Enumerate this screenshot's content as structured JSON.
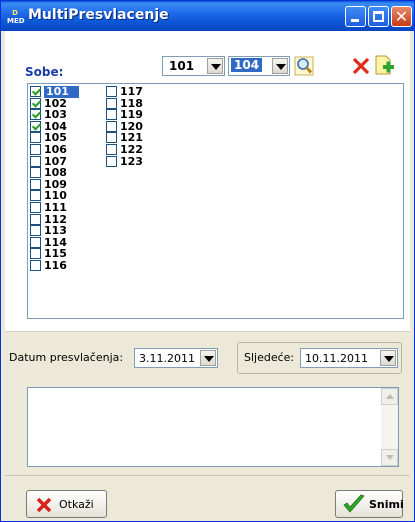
{
  "window": {
    "title": "MultiPresvlacenje",
    "icon_text_top": "D",
    "icon_text_bottom": "MED"
  },
  "rooms": {
    "label": "Sobe:",
    "from": "101",
    "to": "104",
    "column1": [
      {
        "number": "101",
        "checked": true,
        "selected": true
      },
      {
        "number": "102",
        "checked": true
      },
      {
        "number": "103",
        "checked": true
      },
      {
        "number": "104",
        "checked": true
      },
      {
        "number": "105",
        "checked": false
      },
      {
        "number": "106",
        "checked": false
      },
      {
        "number": "107",
        "checked": false
      },
      {
        "number": "108",
        "checked": false
      },
      {
        "number": "109",
        "checked": false
      },
      {
        "number": "110",
        "checked": false
      },
      {
        "number": "111",
        "checked": false
      },
      {
        "number": "112",
        "checked": false
      },
      {
        "number": "113",
        "checked": false
      },
      {
        "number": "114",
        "checked": false
      },
      {
        "number": "115",
        "checked": false
      },
      {
        "number": "116",
        "checked": false
      }
    ],
    "column2": [
      {
        "number": "117",
        "checked": false
      },
      {
        "number": "118",
        "checked": false
      },
      {
        "number": "119",
        "checked": false
      },
      {
        "number": "120",
        "checked": false
      },
      {
        "number": "121",
        "checked": false
      },
      {
        "number": "122",
        "checked": false
      },
      {
        "number": "123",
        "checked": false
      }
    ]
  },
  "dates": {
    "presvlacenje_label": "Datum presvlačenja:",
    "presvlacenje_value": "3.11.2011",
    "sljedece_label": "Sljedeće:",
    "sljedece_value": "10.11.2011"
  },
  "buttons": {
    "cancel_label": "Otkaži",
    "save_label": "Snimi"
  },
  "colors": {
    "title_bar": "#0c57d6",
    "selection": "#316ac5",
    "label_blue": "#1a3ea8",
    "window_bg": "#ece9d8"
  }
}
